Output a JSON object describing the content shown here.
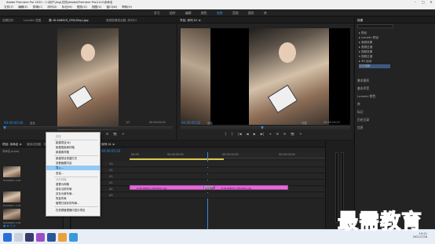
{
  "window": {
    "title": "Adobe Premiere Pro 2020 - C:\\用户\\Jing\\文档\\Adobe\\Premiere Pro\\14.0\\未命名",
    "min": "–",
    "max": "□",
    "close": "✕"
  },
  "menu": [
    "文件(F)",
    "编辑(E)",
    "剪辑(C)",
    "序列(S)",
    "标记(M)",
    "图形(G)",
    "视图(V)",
    "窗口(W)",
    "帮助(H)"
  ],
  "workspace": {
    "items": [
      "学习",
      "组件",
      "编辑",
      "颜色",
      "效果",
      "音频",
      "图形",
      "库"
    ],
    "active": "效果"
  },
  "source": {
    "tabs": [
      "效果控件",
      "Lumetri 范围",
      "源: 8L3A8625_CR5(Ship).jpg",
      "音频剪辑混合器: 序列01"
    ],
    "timecode": "00:00:00:00",
    "fit": "适合",
    "scale": "1/2",
    "end_timecode": "00:00:05:00",
    "controls": [
      "{",
      "}",
      "|◀",
      "◀",
      "▶",
      "▶|",
      "⇥",
      "⊞",
      "⊟",
      "📷",
      "+"
    ]
  },
  "program": {
    "tabs": [
      "节目: 序列 01 ≡"
    ],
    "timecode": "00:00:05:02",
    "fit": "适合",
    "quality": "完整",
    "end_timecode": "00:00:10:23",
    "controls": [
      "{",
      "}",
      "|◀",
      "◀",
      "▶",
      "▶|",
      "⇥",
      "⊞",
      "⊟",
      "📷",
      "+"
    ]
  },
  "effects": {
    "title": "效果",
    "tree": [
      "▸ 预设",
      "▸ Lumetri 预设",
      "▸ 音频效果",
      "▸ 音频过渡",
      "▸ 视频效果",
      "▾ 视频过渡",
      "  ▸ 3D 运动",
      "    交叉溶解"
    ],
    "sections": [
      "基本图形",
      "基本声音",
      "Lumetri 颜色",
      "库",
      "标记",
      "历史记录",
      "信息"
    ]
  },
  "project": {
    "tabs": [
      "项目: 未命名 ≡",
      "媒体浏览器",
      "库",
      "信息"
    ],
    "name": "未命名.prproj",
    "items": [
      {
        "name": "8L3A8625...",
        "dur": "5:00"
      },
      {
        "name": "序列 01",
        "dur": "10:23"
      },
      {
        "name": "8L3A8627...",
        "dur": "5:00"
      },
      {
        "name": "8L3A8630...",
        "dur": "5:00"
      }
    ]
  },
  "context_menu": {
    "items": [
      {
        "label": "粘贴",
        "state": "disabled"
      },
      {
        "label": "新建项目(N)",
        "state": "normal"
      },
      {
        "label": "新建搜索素材箱",
        "state": "normal"
      },
      {
        "label": "新建素材箱",
        "state": "normal"
      },
      {
        "label": "新建项目快捷方式",
        "state": "normal"
      },
      {
        "label": "查看隐藏内容",
        "state": "normal"
      },
      {
        "label": "导入...",
        "state": "highlight"
      },
      {
        "label": "查找...",
        "state": "normal"
      },
      {
        "label": "对齐网格",
        "state": "disabled"
      },
      {
        "label": "重置为网格",
        "state": "normal"
      },
      {
        "label": "保存当前布局",
        "state": "normal"
      },
      {
        "label": "另存为新布局...",
        "state": "normal"
      },
      {
        "label": "恢复布局",
        "state": "normal"
      },
      {
        "label": "管理已保存的布局...",
        "state": "normal"
      },
      {
        "label": "在资源管理器中显示项目",
        "state": "normal"
      }
    ]
  },
  "timeline": {
    "tab": "序列 01 ≡",
    "timecode": "00:00:05:02",
    "ruler": [
      "00:00",
      "00:00:05:00",
      "00:00:10:00",
      "00:00:15:00"
    ],
    "tracks": [
      "V3",
      "V2",
      "V1",
      "A1",
      "A2",
      "A3"
    ],
    "clips": [
      {
        "label": "fx 8L3A8625_CR5(Ship).jpg"
      },
      {
        "label": "交叉溶解"
      },
      {
        "label": "fx 8L3A8627_CR5(Ship).jpg"
      }
    ]
  },
  "taskbar": {
    "time": "19:21",
    "date": "2021/7/28"
  },
  "watermark": "最需教育"
}
